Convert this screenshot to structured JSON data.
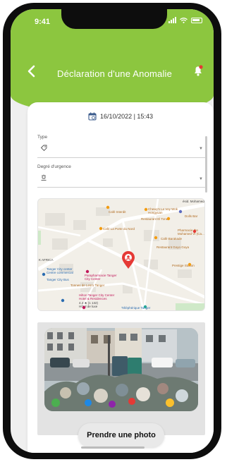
{
  "status": {
    "time": "9:41"
  },
  "header": {
    "title": "Déclaration d'une Anomalie"
  },
  "form": {
    "datetime": "16/10/2022 | 15:43",
    "type_label": "Type",
    "urgency_label": "Degré d'urgence"
  },
  "map": {
    "labels": {
      "street_top": "ésid. Mohamed",
      "cafe_interdit": "Café Interdit",
      "chewy": "Chewy's Le Voy Wok Hongyuan",
      "dolls": "Dolls Bar",
      "restaurant_el_tonel": "Restaurant El Tonel",
      "cafe_porte": "Café La Porte du Nord",
      "cafe_baraka": "Café Barakade",
      "pharmacie": "Pharmacie Ibn Mohamed VI (Ca...",
      "restaurant_goyo": "Restaurant Goyo Goya",
      "africa": "K AFRICA",
      "tanger_city": "Tanger City center",
      "tanger_city_sub": "Centre commercial",
      "tanger_ville": "Tanger City Bus",
      "parapharmacie": "Parapharmacie Tanger City Center",
      "tonnes": "Tonnes de Lesro Tanger",
      "prestige": "Prestige Station",
      "hilton": "Hilton Tanger City Center Hotel & Residences",
      "hilton_rating": "4.4 ★ (1 132)",
      "hilton_sub": "Hôtel de luxe",
      "telepherique": "Téléphérique Tanger"
    }
  },
  "photo": {
    "button_label": "Prendre une photo"
  },
  "colors": {
    "accent": "#8cc63f",
    "marker": "#e53935"
  }
}
